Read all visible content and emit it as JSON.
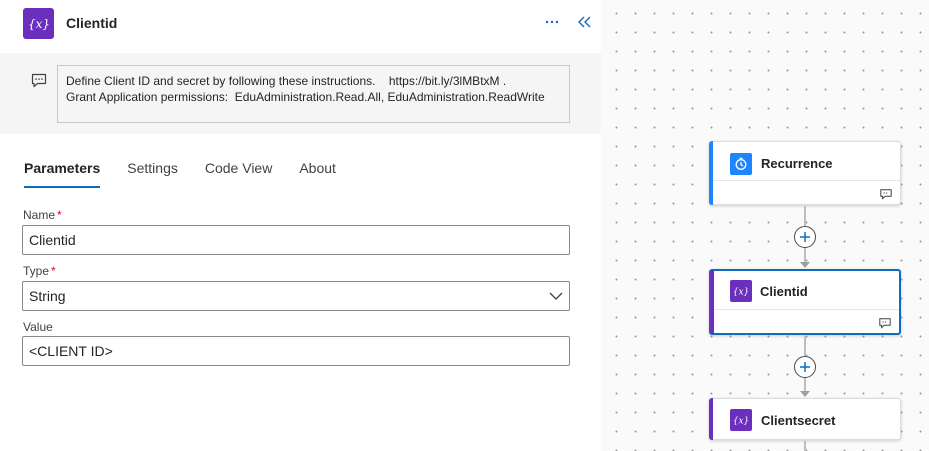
{
  "panel": {
    "title": "Clientid",
    "icon": "variable-icon",
    "actions": {
      "more": "more-options-icon",
      "collapse": "collapse-panel-icon"
    },
    "note": "Define Client ID and secret by following these instructions.    https://bit.ly/3lMBtxM .\nGrant Application permissions:  EduAdministration.Read.All, EduAdministration.ReadWrite",
    "tabs": [
      {
        "label": "Parameters",
        "active": true
      },
      {
        "label": "Settings",
        "active": false
      },
      {
        "label": "Code View",
        "active": false
      },
      {
        "label": "About",
        "active": false
      }
    ],
    "fields": {
      "name": {
        "label": "Name",
        "required": "*",
        "value": "Clientid"
      },
      "type": {
        "label": "Type",
        "required": "*",
        "value": "String"
      },
      "value": {
        "label": "Value",
        "value": "<CLIENT ID>"
      }
    }
  },
  "canvas": {
    "cards": [
      {
        "title": "Recurrence",
        "icon": "clock-icon",
        "color": "#1f85ff"
      },
      {
        "title": "Clientid",
        "icon": "variable-icon",
        "color": "#6b2fbd",
        "selected": true
      },
      {
        "title": "Clientsecret",
        "icon": "variable-icon",
        "color": "#6b2fbd"
      }
    ]
  },
  "colors": {
    "accent": "#0f6cbd",
    "variable": "#6b2fbd",
    "recurrence": "#1f85ff"
  }
}
